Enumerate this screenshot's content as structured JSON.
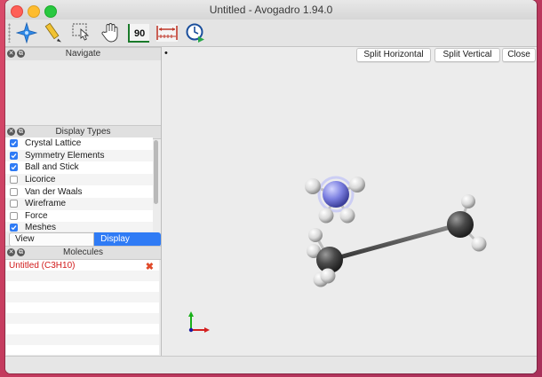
{
  "window": {
    "title": "Untitled - Avogadro 1.94.0"
  },
  "toolbar": {
    "tools": [
      {
        "name": "navigate-tool-icon"
      },
      {
        "name": "draw-tool-icon"
      },
      {
        "name": "select-tool-icon"
      },
      {
        "name": "manipulate-tool-icon"
      },
      {
        "name": "measure-tool-icon",
        "label": "90"
      },
      {
        "name": "align-tool-icon"
      },
      {
        "name": "auto-optimize-tool-icon"
      }
    ]
  },
  "navigate_panel": {
    "title": "Navigate"
  },
  "display_types_panel": {
    "title": "Display Types",
    "items": [
      {
        "label": "Crystal Lattice",
        "checked": true
      },
      {
        "label": "Symmetry Elements",
        "checked": true
      },
      {
        "label": "Ball and Stick",
        "checked": true
      },
      {
        "label": "Licorice",
        "checked": false
      },
      {
        "label": "Van der Waals",
        "checked": false
      },
      {
        "label": "Wireframe",
        "checked": false
      },
      {
        "label": "Force",
        "checked": false
      },
      {
        "label": "Meshes",
        "checked": true
      }
    ],
    "tabs": {
      "view_configuration": "View Configuration",
      "display_types": "Display Types"
    }
  },
  "molecules_panel": {
    "title": "Molecules",
    "items": [
      {
        "label": "Untitled (C3H10)"
      }
    ]
  },
  "viewport": {
    "buttons": {
      "split_horizontal": "Split Horizontal",
      "split_vertical": "Split Vertical",
      "close": "Close"
    },
    "indicator": "•"
  },
  "colors": {
    "accent": "#2f7bf5",
    "molecule_text": "#d11a1a",
    "nitrogen": "#7b7fe0",
    "carbon": "#4a4a4a",
    "hydrogen": "#e4e4e4"
  }
}
